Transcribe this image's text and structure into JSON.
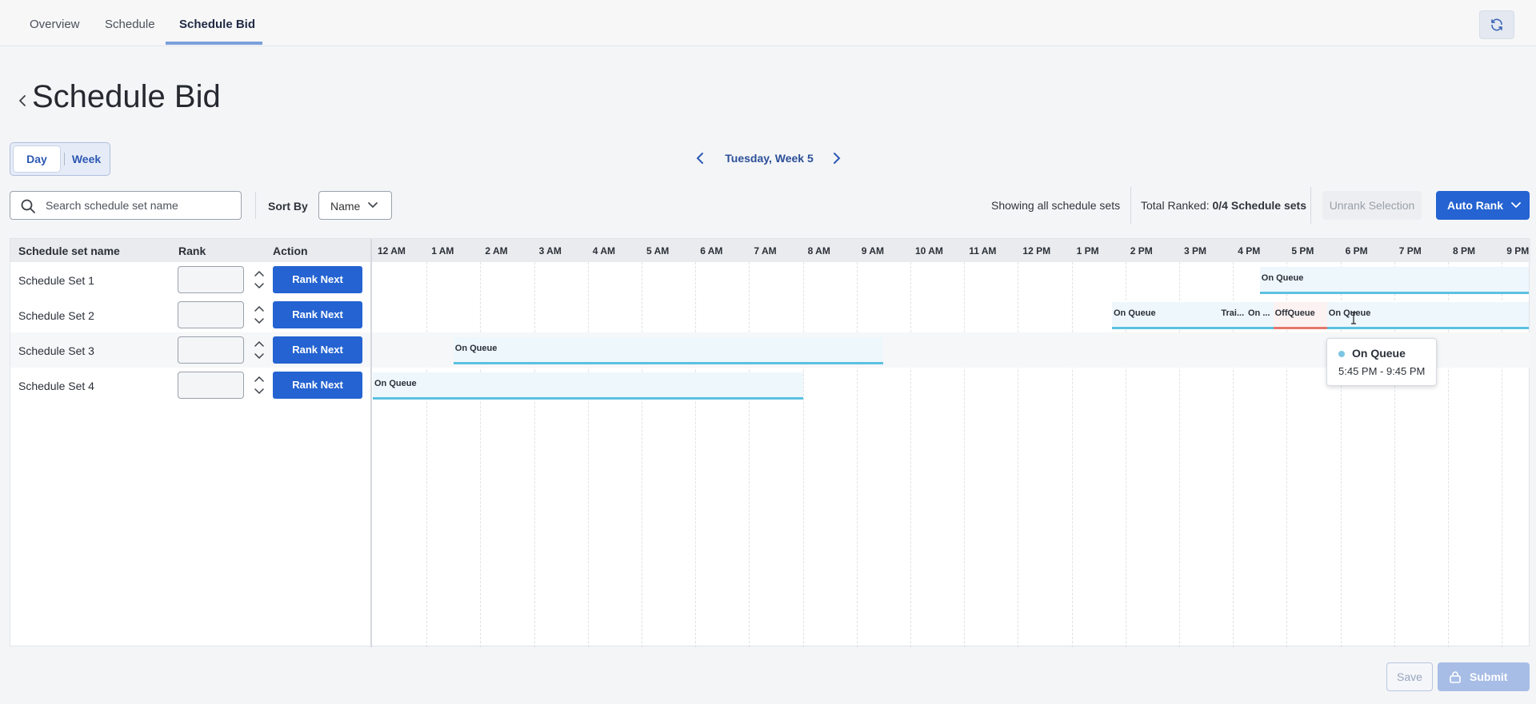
{
  "tabs": [
    {
      "label": "Overview",
      "active": false
    },
    {
      "label": "Schedule",
      "active": false
    },
    {
      "label": "Schedule Bid",
      "active": true
    }
  ],
  "page": {
    "title": "Schedule Bid"
  },
  "view_toggle": {
    "day": "Day",
    "week": "Week",
    "selected": "Day"
  },
  "date_nav": {
    "label": "Tuesday, Week 5"
  },
  "search": {
    "placeholder": "Search schedule set name",
    "value": ""
  },
  "sort": {
    "label": "Sort By",
    "value": "Name"
  },
  "summary": {
    "showing": "Showing all schedule sets",
    "ranked_prefix": "Total Ranked: ",
    "ranked_value": "0/4 Schedule sets"
  },
  "buttons": {
    "unrank": "Unrank Selection",
    "auto_rank": "Auto Rank",
    "save": "Save",
    "submit": "Submit"
  },
  "table": {
    "headers": {
      "name": "Schedule set name",
      "rank": "Rank",
      "action": "Action"
    },
    "hours": [
      "12 AM",
      "1 AM",
      "2 AM",
      "3 AM",
      "4 AM",
      "5 AM",
      "6 AM",
      "7 AM",
      "8 AM",
      "9 AM",
      "10 AM",
      "11 AM",
      "12 PM",
      "1 PM",
      "2 PM",
      "3 PM",
      "4 PM",
      "5 PM",
      "6 PM",
      "7 PM",
      "8 PM",
      "9 PM"
    ],
    "rank_next_label": "Rank Next",
    "rows": [
      {
        "name": "Schedule Set 1",
        "rank": "",
        "activities": [
          {
            "label": "On Queue",
            "start": 16.5,
            "end": 21.6,
            "type": "queue"
          }
        ]
      },
      {
        "name": "Schedule Set 2",
        "rank": "",
        "activities": [
          {
            "label": "On Queue",
            "start": 13.75,
            "end": 15.75,
            "type": "queue"
          },
          {
            "label": "Trai...",
            "start": 15.75,
            "end": 16.25,
            "type": "queue"
          },
          {
            "label": "On ...",
            "start": 16.25,
            "end": 16.75,
            "type": "queue"
          },
          {
            "label": "OffQueue",
            "start": 16.75,
            "end": 17.75,
            "type": "off"
          },
          {
            "label": "On Queue",
            "start": 17.75,
            "end": 21.6,
            "type": "queue"
          }
        ]
      },
      {
        "name": "Schedule Set 3",
        "rank": "",
        "activities": [
          {
            "label": "On Queue",
            "start": 1.5,
            "end": 9.5,
            "type": "queue"
          }
        ]
      },
      {
        "name": "Schedule Set 4",
        "rank": "",
        "activities": [
          {
            "label": "On Queue",
            "start": 0,
            "end": 8,
            "type": "queue"
          }
        ]
      }
    ]
  },
  "tooltip": {
    "title": "On Queue",
    "time": "5:45 PM - 9:45 PM"
  },
  "colors": {
    "primary": "#2463d1",
    "queue": "#5cc1e0",
    "off_queue": "#e6766a",
    "accent_tab": "#7aa0dd"
  }
}
